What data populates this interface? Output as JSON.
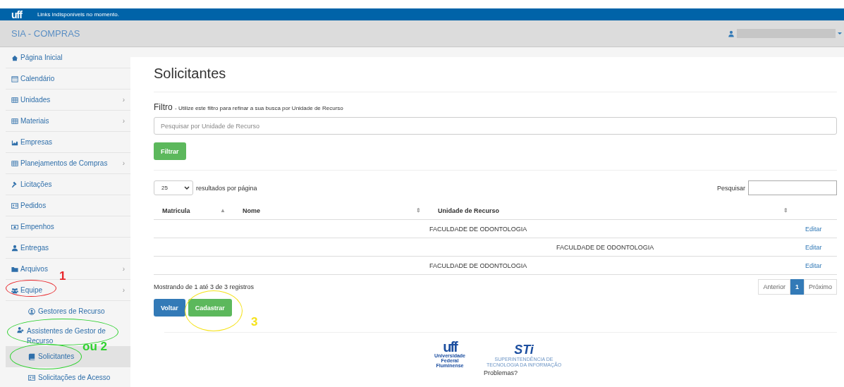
{
  "topbar": {
    "logo": "uff",
    "notice": "Links indisponíveis no momento."
  },
  "header": {
    "title": "SIA - COMPRAS"
  },
  "sidebar": {
    "items": [
      {
        "label": "Página Inicial",
        "kind": "home",
        "selected": false
      },
      {
        "label": "Calendário",
        "kind": "calendar",
        "selected": false
      },
      {
        "label": "Unidades",
        "kind": "table",
        "chevron": "›",
        "selected": false
      },
      {
        "label": "Materiais",
        "kind": "table",
        "chevron": "›",
        "selected": false
      },
      {
        "label": "Empresas",
        "kind": "chart",
        "selected": false
      },
      {
        "label": "Planejamentos de Compras",
        "kind": "table",
        "chevron": "›",
        "selected": false
      },
      {
        "label": "Licitações",
        "kind": "gavel",
        "selected": false
      },
      {
        "label": "Pedidos",
        "kind": "card",
        "selected": false
      },
      {
        "label": "Empenhos",
        "kind": "money",
        "selected": false
      },
      {
        "label": "Entregas",
        "kind": "person",
        "selected": false
      },
      {
        "label": "Arquivos",
        "kind": "folder",
        "chevron": "›",
        "selected": false
      },
      {
        "label": "Equipe",
        "kind": "users",
        "chevron": "›",
        "selected": false,
        "children": [
          {
            "label": "Gestores de Recurso",
            "kind": "usercircle",
            "selected": false
          },
          {
            "label": "Assistentes de Gestor de Recurso",
            "kind": "useradd",
            "selected": false
          },
          {
            "label": "Solicitantes",
            "kind": "book",
            "selected": true
          },
          {
            "label": "Solicitações de Acesso",
            "kind": "card",
            "selected": false
          }
        ]
      }
    ]
  },
  "main": {
    "title": "Solicitantes",
    "filter": {
      "label": "Filtro",
      "hint": "- Utilize este filtro para refinar a sua busca por Unidade de Recurso",
      "placeholder": "Pesquisar por Unidade de Recurso",
      "button": "Filtrar"
    },
    "page_size": {
      "value": "25",
      "label": "resultados por página"
    },
    "search": {
      "label": "Pesquisar"
    },
    "table": {
      "columns": [
        {
          "label": "Matricula",
          "sort_icon": "▲"
        },
        {
          "label": "Nome",
          "sort_icon": "⇕"
        },
        {
          "label": "Unidade de Recurso",
          "sort_icon": "⇕"
        }
      ],
      "rows": [
        {
          "unidade": "FACULDADE DE ODONTOLOGIA",
          "action": "Editar"
        },
        {
          "unidade": "FACULDADE DE ODONTOLOGIA",
          "action": "Editar"
        },
        {
          "unidade": "FACULDADE DE ODONTOLOGIA",
          "action": "Editar"
        }
      ]
    },
    "info": "Mostrando de 1 até 3 de 3 registros",
    "pagination": [
      {
        "label": "Anterior",
        "selected": false
      },
      {
        "label": "1",
        "selected": true
      },
      {
        "label": "Próximo",
        "selected": false
      }
    ],
    "buttons": [
      {
        "label": "Voltar",
        "kind": "primary"
      },
      {
        "label": "Cadastrar",
        "kind": "success"
      }
    ]
  },
  "footer": {
    "logo": "uff",
    "logo_caption": "Universidade Federal Fluminense",
    "sti": "STi",
    "sti_caption": "SUPERINTENDÊNCIA DE TECNOLOGIA DA INFORMAÇÃO",
    "help": "Problemas?"
  },
  "annotations": [
    {
      "text": "1",
      "color": "#e8262b"
    },
    {
      "text": "ou 2",
      "color": "#2fd12f"
    },
    {
      "text": "3",
      "color": "#f5e21a"
    }
  ]
}
